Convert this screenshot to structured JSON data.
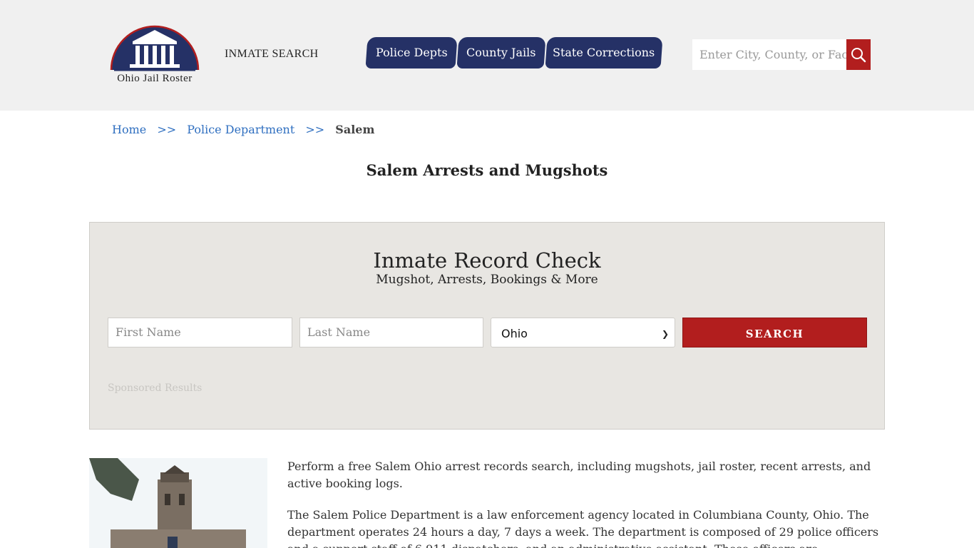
{
  "header": {
    "logo_text": "Ohio Jail Roster",
    "inmate_search_label": "INMATE SEARCH",
    "nav": [
      {
        "label": "Police Depts"
      },
      {
        "label": "County Jails"
      },
      {
        "label": "State Corrections"
      }
    ],
    "search_placeholder": "Enter City, County, or Facility",
    "colors": {
      "nav": "#253166",
      "accent": "#b21e1e",
      "header_bg": "#f0f0f0"
    }
  },
  "breadcrumb": {
    "home": "Home",
    "sep": ">>",
    "police": "Police Department",
    "current": "Salem"
  },
  "page_title": "Salem Arrests and Mugshots",
  "record_check": {
    "title": "Inmate Record Check",
    "subtitle": "Mugshot, Arrests, Bookings & More",
    "first_name_placeholder": "First Name",
    "last_name_placeholder": "Last Name",
    "state_selected": "Ohio",
    "search_label": "SEARCH",
    "sponsored": "Sponsored Results"
  },
  "content": {
    "p1": "Perform a free Salem Ohio arrest records search, including mugshots, jail roster, recent arrests, and active booking logs.",
    "p2": "The Salem Police Department is a law enforcement agency located in Columbiana County, Ohio. The department operates 24 hours a day, 7 days a week. The department is composed of 29 police officers and a support staff of 6 911 dispatchers, and an administrative assistant. These officers are responsible for"
  }
}
